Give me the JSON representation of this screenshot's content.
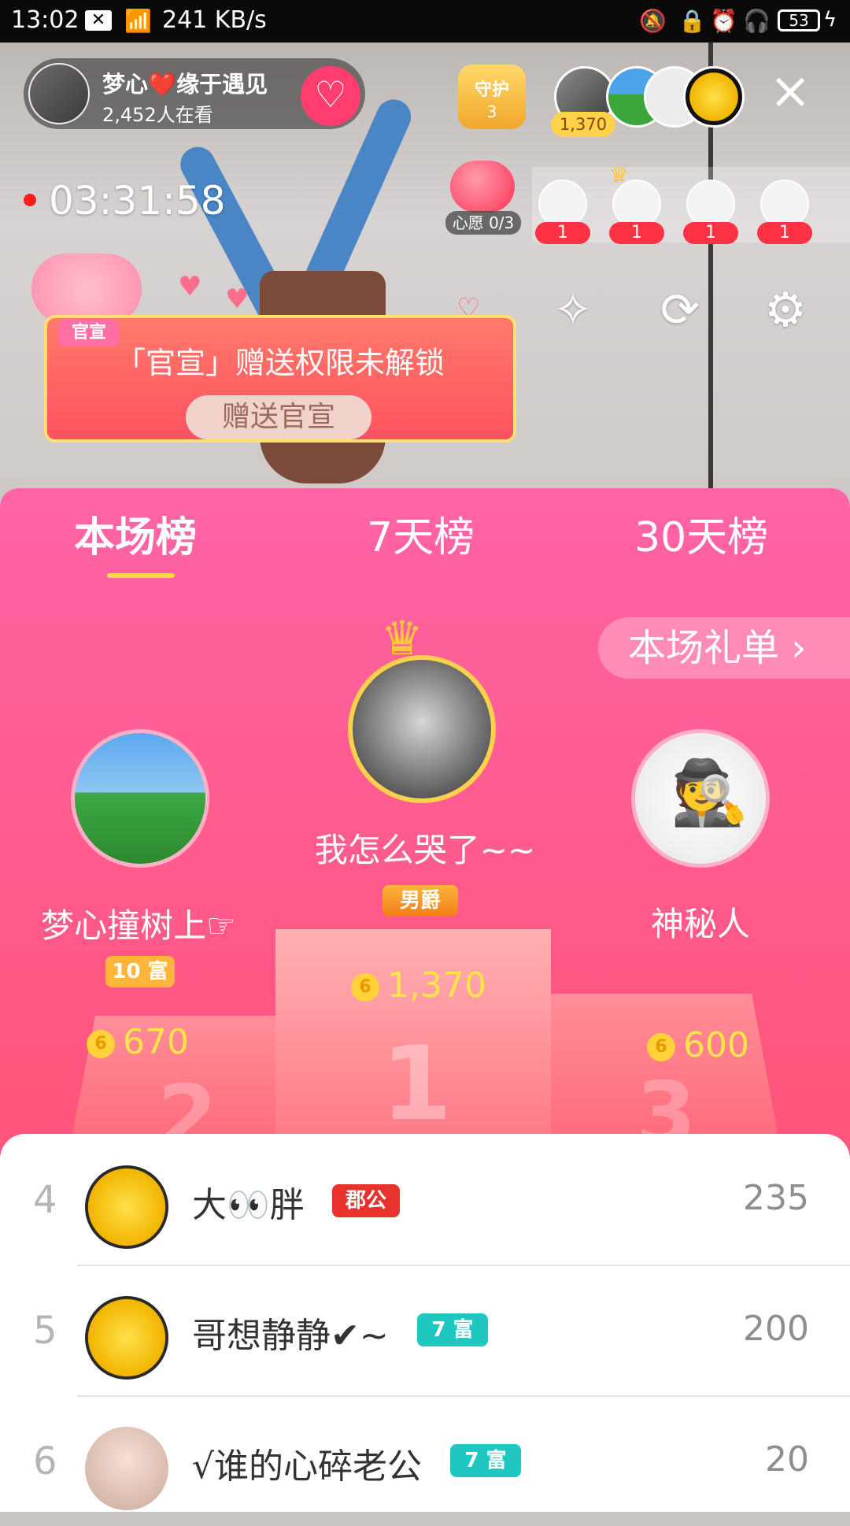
{
  "status_bar": {
    "time": "13:02",
    "speed": "241 KB/s",
    "battery": "53"
  },
  "host": {
    "name": "梦心❤️缘于遇见",
    "viewers": "2,452人在看"
  },
  "guard": {
    "label": "守护",
    "count": "3"
  },
  "top_viewers": {
    "count": "1,370"
  },
  "timer": "03:31:58",
  "wish": {
    "label": "心愿 0/3"
  },
  "fans": [
    {
      "badge": "1"
    },
    {
      "badge": "1"
    },
    {
      "badge": "1"
    },
    {
      "badge": "1"
    }
  ],
  "guanxuan": {
    "tag": "官宣",
    "title": "「官宣」赠送权限未解锁",
    "button": "赠送官宣"
  },
  "tabs": [
    "本场榜",
    "7天榜",
    "30天榜"
  ],
  "gift_list_label": "本场礼单 ›",
  "podium": {
    "first": {
      "name": "我怎么哭了~~",
      "level": "男爵",
      "amount": "1,370"
    },
    "second": {
      "name": "梦心撞树上☞",
      "level": "10 富",
      "amount": "670"
    },
    "third": {
      "name": "神秘人",
      "amount": "600"
    },
    "labels": [
      "1",
      "2",
      "3"
    ]
  },
  "list": [
    {
      "rank": "4",
      "name": "大👀胖",
      "badge": "郡公",
      "badge_color": "#e8322e",
      "score": "235"
    },
    {
      "rank": "5",
      "name": "哥想静静✔~",
      "badge": "7 富",
      "badge_color": "#1ec8c0",
      "score": "200"
    },
    {
      "rank": "6",
      "name": "√谁的心碎老公",
      "badge": "7 富",
      "badge_color": "#1ec8c0",
      "score": "20"
    }
  ],
  "coin_icon": "6",
  "colors": {
    "panel_top": "#ff64a6",
    "panel_bottom": "#ff4a66",
    "accent_gold": "#ffd54a"
  }
}
